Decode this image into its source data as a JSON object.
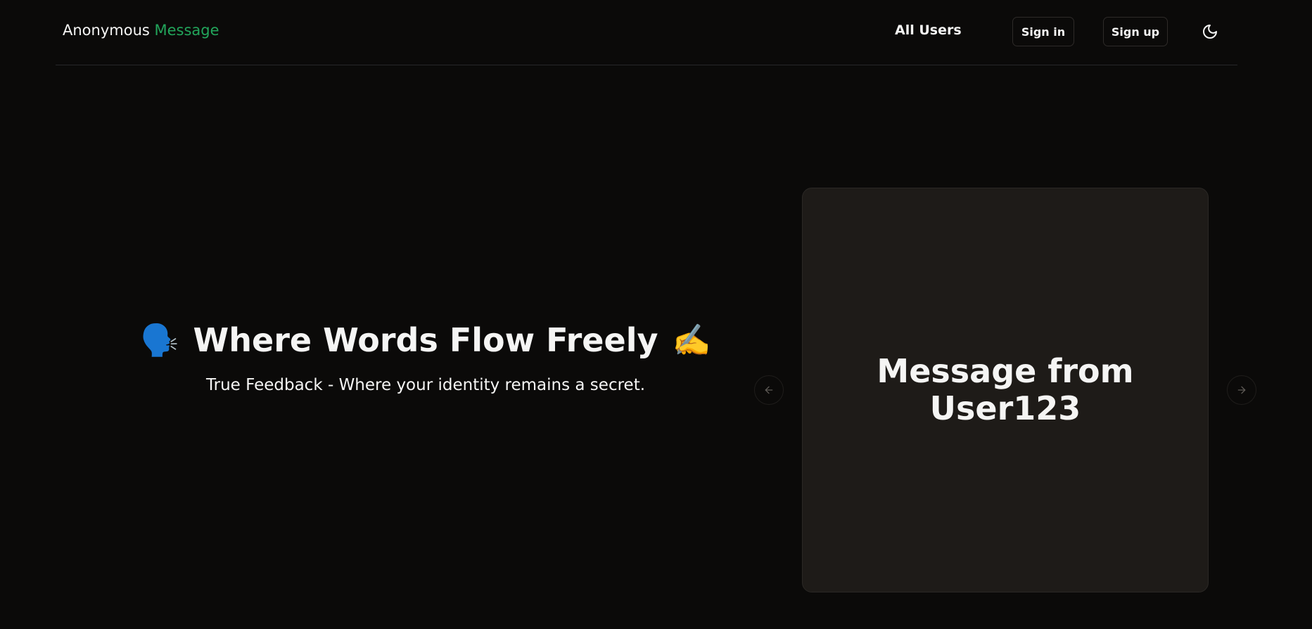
{
  "navbar": {
    "brand_prefix": "Anonymous",
    "brand_accent": "Message",
    "all_users_label": "All Users",
    "signin_label": "Sign in",
    "signup_label": "Sign up",
    "theme_icon": "moon-icon"
  },
  "hero": {
    "title": "Where Words Flow Freely",
    "title_emoji_left": "🗣️",
    "title_emoji_right": "✍️",
    "subtitle": "True Feedback - Where your identity remains a secret."
  },
  "carousel": {
    "prev_icon": "arrow-left-icon",
    "next_icon": "arrow-right-icon",
    "card_text": "Message from User123"
  },
  "colors": {
    "background": "#0b0a09",
    "accent": "#22a55b",
    "card_background": "#1e1b18",
    "text": "#f5f5f4"
  }
}
